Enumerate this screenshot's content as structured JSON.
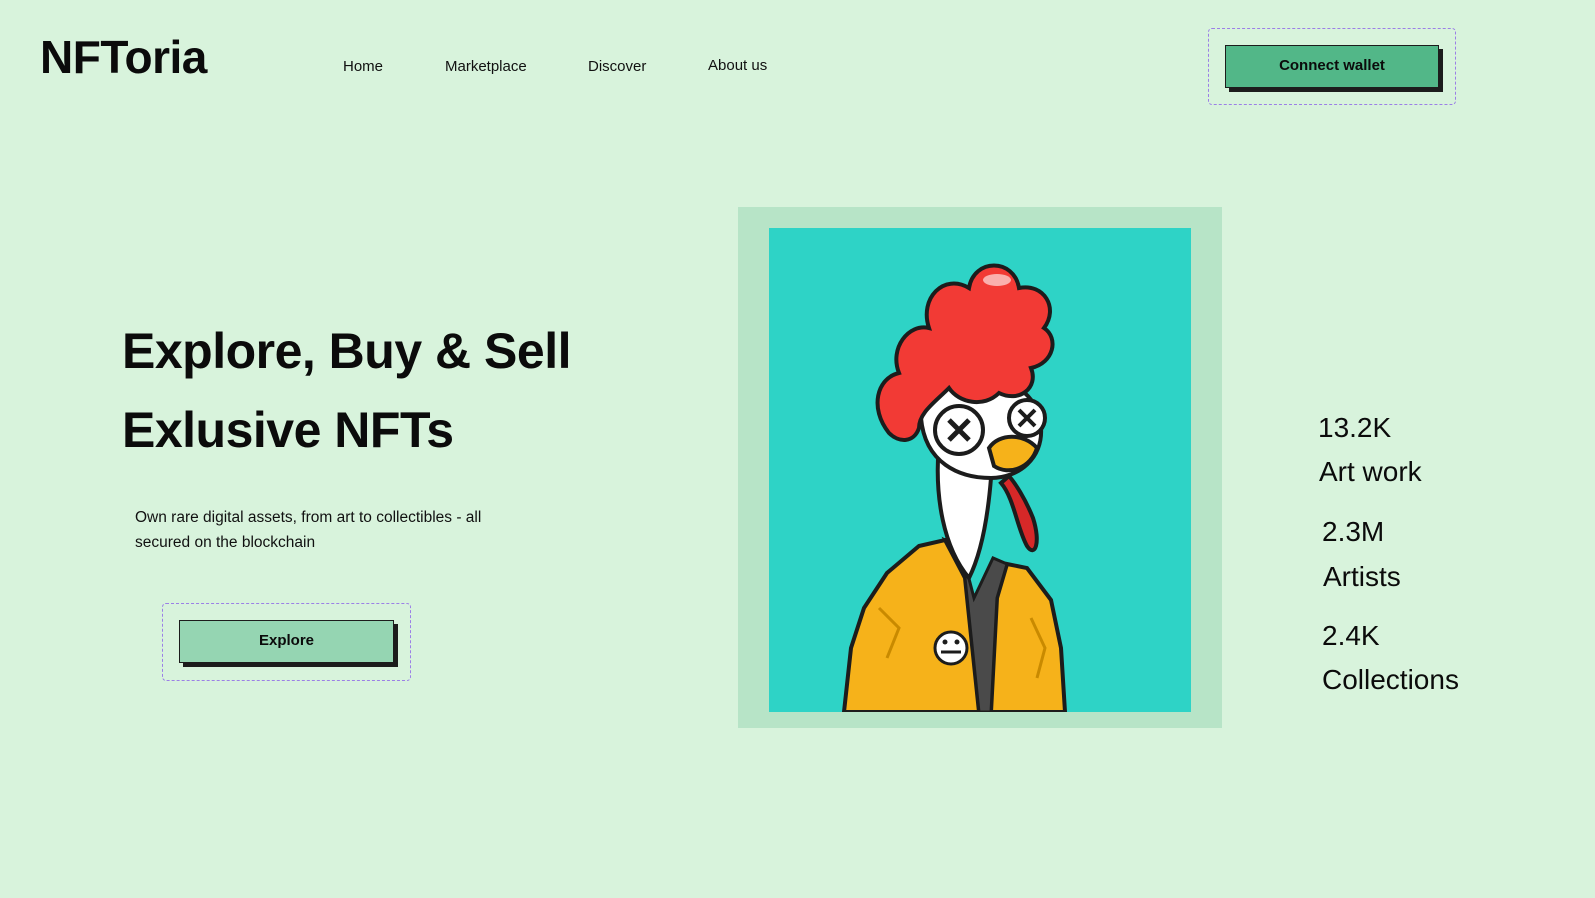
{
  "brand": {
    "name": "NFToria"
  },
  "nav": {
    "items": [
      {
        "label": "Home"
      },
      {
        "label": "Marketplace"
      },
      {
        "label": "Discover"
      },
      {
        "label": "About us"
      }
    ]
  },
  "header": {
    "connect_label": "Connect wallet"
  },
  "hero": {
    "title_line1": "Explore, Buy & Sell",
    "title_line2": "Exlusive NFTs",
    "subtitle": "Own rare digital assets, from art to collectibles - all secured on the blockchain",
    "explore_label": "Explore"
  },
  "artwork": {
    "icon": "rooster-nft-illustration"
  },
  "stats": [
    {
      "value": "13.2K",
      "label": "Art work"
    },
    {
      "value": "2.3M",
      "label": "Artists"
    },
    {
      "value": "2.4K",
      "label": "Collections"
    }
  ],
  "colors": {
    "background": "#d8f3dc",
    "connect_button": "#52b788",
    "explore_button": "#95d5b2",
    "art_frame": "#b7e4c7",
    "art_background": "#2ed3c6",
    "dashed_outline": "#9b7fe6"
  }
}
